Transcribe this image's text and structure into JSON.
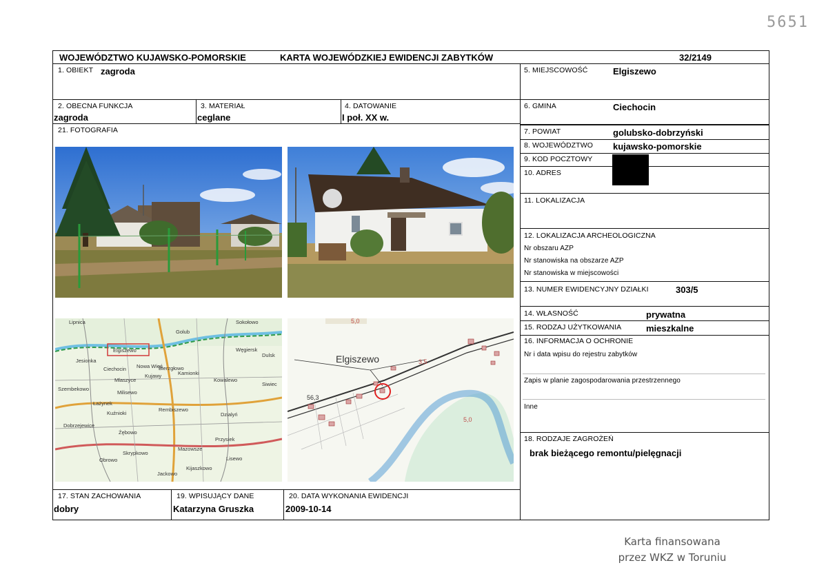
{
  "handwritten_number": "5651",
  "header": {
    "region": "WOJEWÓDZTWO KUJAWSKO-POMORSKIE",
    "title": "KARTA WOJEWÓDZKIEJ EWIDENCJI ZABYTKÓW",
    "number": "32/2149"
  },
  "fields": {
    "obiekt": {
      "label": "1. OBIEKT",
      "value": "zagroda"
    },
    "funkcja": {
      "label": "2. OBECNA FUNKCJA",
      "value": "zagroda"
    },
    "material": {
      "label": "3. MATERIAŁ",
      "value": "ceglane"
    },
    "datowanie": {
      "label": "4. DATOWANIE",
      "value": "I poł. XX w."
    },
    "miejscowosc": {
      "label": "5. MIEJSCOWOŚĆ",
      "value": "Elgiszewo"
    },
    "gmina": {
      "label": "6. GMINA",
      "value": "Ciechocin"
    },
    "powiat": {
      "label": "7. POWIAT",
      "value": "golubsko-dobrzyński"
    },
    "wojewodztwo": {
      "label": "8. WOJEWÓDZTWO",
      "value": "kujawsko-pomorskie"
    },
    "kod": {
      "label": "9. KOD POCZTOWY"
    },
    "adres": {
      "label": "10. ADRES"
    },
    "lokalizacja": {
      "label": "11. LOKALIZACJA"
    },
    "archeo": {
      "label": "12. LOKALIZACJA ARCHEOLOGICZNA",
      "line1": "Nr obszaru AZP",
      "line2": "Nr stanowiska na obszarze AZP",
      "line3": "Nr stanowiska w miejscowości"
    },
    "dzialka": {
      "label": "13. NUMER EWIDENCYJNY DZIAŁKI",
      "value": "303/5"
    },
    "wlasnosc": {
      "label": "14. WŁASNOŚĆ",
      "value": "prywatna"
    },
    "uzytkowanie": {
      "label": "15. RODZAJ UŻYTKOWANIA",
      "value": "mieszkalne"
    },
    "ochrona": {
      "label": "16. INFORMACJA O OCHRONIE",
      "line1": "Nr i data wpisu do rejestru zabytków",
      "line2": "Zapis w planie zagospodarowania przestrzennego",
      "line3": "Inne"
    },
    "stan": {
      "label": "17. STAN ZACHOWANIA",
      "value": "dobry"
    },
    "zagrozenia": {
      "label": "18. RODZAJE ZAGROŻEŃ",
      "value": "brak bieżącego remontu/pielęgnacji"
    },
    "wpisujacy": {
      "label": "19. WPISUJĄCY DANE",
      "value": "Katarzyna Gruszka"
    },
    "data": {
      "label": "20. DATA WYKONANIA EWIDENCJI",
      "value": "2009-10-14"
    },
    "fotografia": {
      "label": "21. FOTOGRAFIA"
    }
  },
  "road_map": {
    "place_labels": [
      "Elgiszewo",
      "Ciechocin",
      "Nowa Wieś",
      "Jesionka",
      "Sokołowo",
      "Węgiersk",
      "Dulsk",
      "Golub",
      "Lipnica",
      "Szembekowo",
      "Łażynek",
      "Kuźnioki",
      "Dobrzejewice",
      "Żębowo",
      "Obrowo",
      "Kamionki",
      "Kowalewo",
      "Dzialyń",
      "Rembiszewo",
      "Mazowsze",
      "Przysiek",
      "Skrypkowo",
      "Jackowo",
      "Kijaszkowo",
      "Lisewo",
      "Bierzgłowo",
      "Mlaszyce",
      "Kujawy",
      "Milisewo",
      "Siwiec"
    ]
  },
  "site_map": {
    "place_label": "Elgiszewo",
    "spot_heights": [
      "56,3",
      "3,5",
      "5,0",
      "5,0"
    ]
  },
  "stamp": {
    "line1": "Karta finansowana",
    "line2": "przez WKZ w Toruniu"
  }
}
